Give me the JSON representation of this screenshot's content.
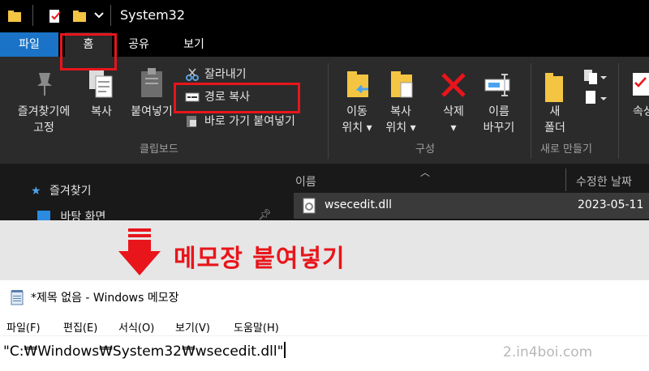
{
  "explorer": {
    "window_title": "System32",
    "tabs": {
      "file": "파일",
      "home": "홈",
      "share": "공유",
      "view": "보기"
    },
    "ribbon": {
      "pin_label": "즐겨찾기에\n고정",
      "copy_label": "복사",
      "paste_label": "붙여넣기",
      "cut_label": "잘라내기",
      "copy_path_label": "경로 복사",
      "paste_shortcut_label": "바로 가기 붙여넣기",
      "clipboard_group": "클립보드",
      "move_to_label": "이동\n위치 ▾",
      "copy_to_label": "복사\n위치 ▾",
      "delete_label": "삭제\n▾",
      "rename_label": "이름\n바꾸기",
      "organize_group": "구성",
      "new_folder_label": "새\n폴더",
      "new_group": "새로 만들기",
      "properties_label": "속성"
    },
    "nav": {
      "quick_access": "즐겨찾기",
      "desktop": "바탕 화면"
    },
    "columns": {
      "name": "이름",
      "modified": "수정한 날짜"
    },
    "file_row": {
      "name": "wsecedit.dll",
      "date": "2023-05-11"
    }
  },
  "band_text": "메모장 붙여넣기",
  "notepad": {
    "title": "*제목 없음 - Windows 메모장",
    "menu": [
      "파일(F)",
      "편집(E)",
      "서식(O)",
      "보기(V)",
      "도움말(H)"
    ],
    "content": "\"C:₩Windows₩System32₩wsecedit.dll\""
  },
  "watermark": "2.in4boi.com",
  "colors": {
    "accent_red": "#e8151b",
    "file_tab_blue": "#1a73c7",
    "ribbon_bg": "#2b2b2b"
  }
}
